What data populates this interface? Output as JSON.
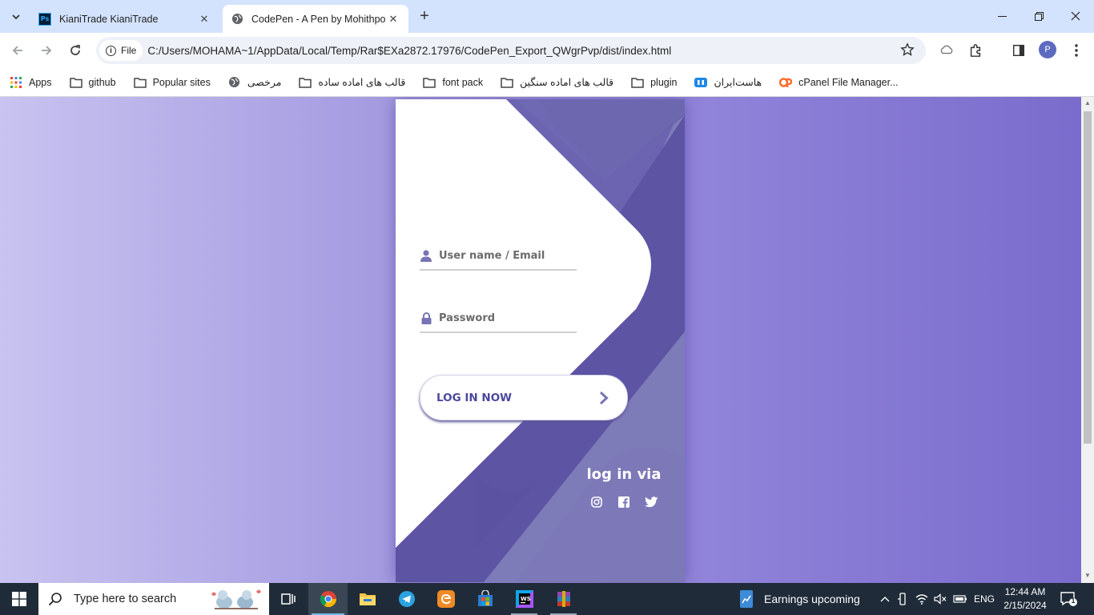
{
  "browser": {
    "tabs": [
      {
        "title": "KianiTrade KianiTrade",
        "icon": "photoshop-icon"
      },
      {
        "title": "CodePen - A Pen by Mohithpoojary",
        "icon": "globe-icon"
      }
    ],
    "file_label": "File",
    "url": "C:/Users/MOHAMA~1/AppData/Local/Temp/Rar$EXa2872.17976/CodePen_Export_QWgrPvp/dist/index.html",
    "profile_initial": "P"
  },
  "bookmarks": [
    {
      "label": "Apps",
      "icon": "apps-grid-icon"
    },
    {
      "label": "github",
      "icon": "folder-icon"
    },
    {
      "label": "Popular sites",
      "icon": "folder-icon"
    },
    {
      "label": "مرخصی",
      "icon": "globe-icon"
    },
    {
      "label": "قالب های اماده ساده",
      "icon": "folder-icon"
    },
    {
      "label": "font pack",
      "icon": "folder-icon"
    },
    {
      "label": "قالب های اماده سنگین",
      "icon": "folder-icon"
    },
    {
      "label": "plugin",
      "icon": "folder-icon"
    },
    {
      "label": "هاست‌ایران",
      "icon": "hostiran-icon"
    },
    {
      "label": "cPanel File Manager...",
      "icon": "cpanel-icon"
    }
  ],
  "login": {
    "username_placeholder": "User name / Email",
    "password_placeholder": "Password",
    "button_label": "LOG IN NOW",
    "social_title": "log in via",
    "social_icons": [
      "instagram-icon",
      "facebook-icon",
      "twitter-icon"
    ],
    "colors": {
      "primary": "#4c489d",
      "accent": "#5d54a4",
      "deep": "#6a679e",
      "light": "#7e7bb9",
      "background_left": "#c8c3f0",
      "background_right": "#7a6ccc"
    }
  },
  "taskbar": {
    "search_placeholder": "Type here to search",
    "apps": [
      "task-view-icon",
      "chrome-icon",
      "file-explorer-icon",
      "telegram-icon",
      "edge-legacy-icon",
      "store-icon",
      "webstorm-icon",
      "winrar-icon"
    ],
    "weather_text": "Earnings upcoming",
    "language": "ENG",
    "time": "12:44 AM",
    "date": "2/15/2024",
    "notification_count": "1"
  }
}
